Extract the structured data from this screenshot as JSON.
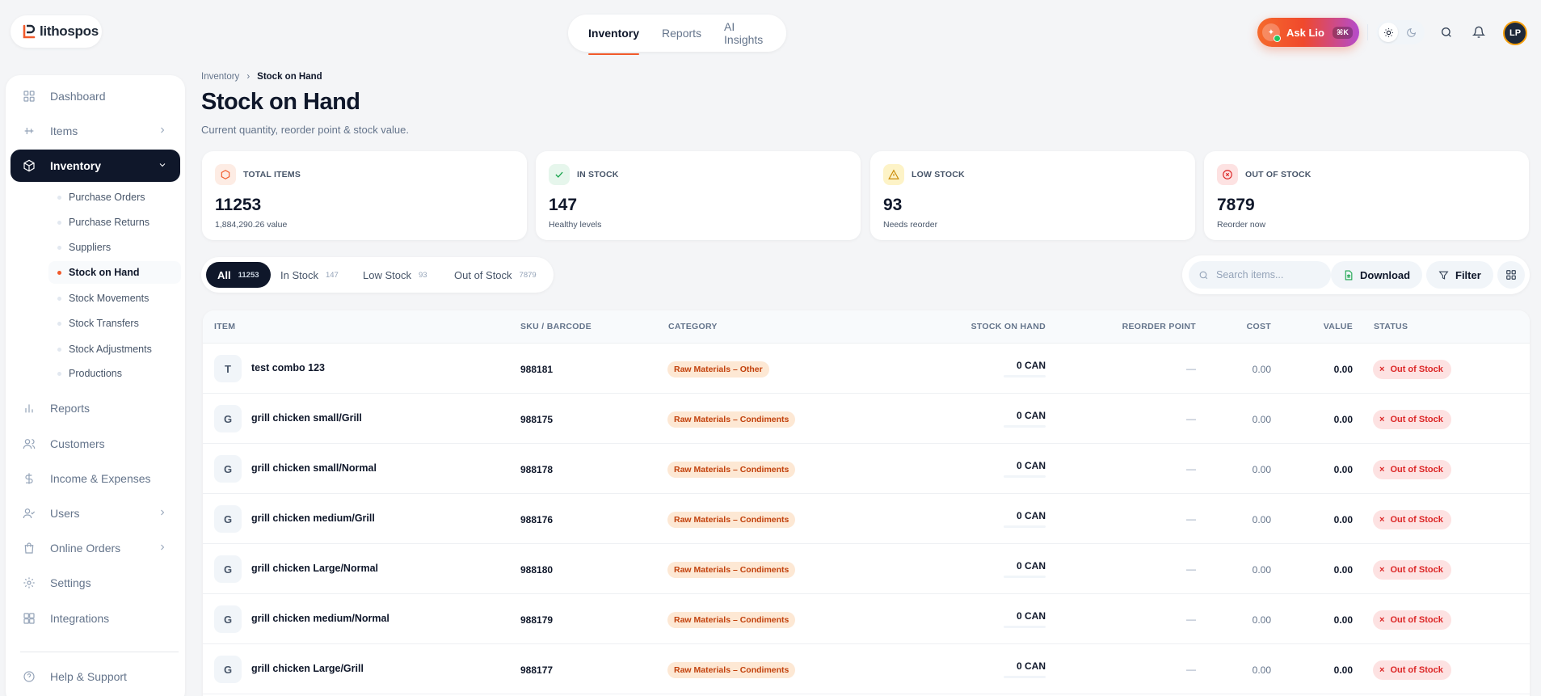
{
  "brand": {
    "name": "lithospos"
  },
  "topnav": [
    {
      "label": "Inventory",
      "active": true
    },
    {
      "label": "Reports",
      "active": false
    },
    {
      "label": "AI Insights",
      "active": false
    }
  ],
  "header": {
    "ask_label": "Ask Lio",
    "ask_shortcut": "⌘K",
    "avatar_initials": "LP"
  },
  "sidebar": {
    "items": [
      {
        "label": "Dashboard",
        "icon": "grid-icon"
      },
      {
        "label": "Items",
        "icon": "sliders-icon"
      },
      {
        "label": "Inventory",
        "icon": "box-icon"
      },
      {
        "label": "Reports",
        "icon": "bar-chart-icon"
      },
      {
        "label": "Customers",
        "icon": "users-icon"
      },
      {
        "label": "Income & Expenses",
        "icon": "dollar-icon"
      },
      {
        "label": "Users",
        "icon": "user-check-icon"
      },
      {
        "label": "Online Orders",
        "icon": "shopping-bag-icon"
      },
      {
        "label": "Settings",
        "icon": "gear-icon"
      },
      {
        "label": "Integrations",
        "icon": "apps-icon"
      },
      {
        "label": "Help & Support",
        "icon": "help-icon"
      }
    ],
    "subitems": [
      {
        "label": "Purchase Orders"
      },
      {
        "label": "Purchase Returns"
      },
      {
        "label": "Suppliers"
      },
      {
        "label": "Stock on Hand"
      },
      {
        "label": "Stock Movements"
      },
      {
        "label": "Stock Transfers"
      },
      {
        "label": "Stock Adjustments"
      },
      {
        "label": "Productions"
      }
    ]
  },
  "breadcrumb": {
    "parent": "Inventory",
    "separator": "›",
    "current": "Stock on Hand"
  },
  "page": {
    "title": "Stock on Hand",
    "subtitle": "Current quantity, reorder point & stock value."
  },
  "stats": [
    {
      "label": "TOTAL ITEMS",
      "value": "11253",
      "note": "1,884,290.26 value",
      "color": "#f15a2b",
      "bg": "#fdece4"
    },
    {
      "label": "IN STOCK",
      "value": "147",
      "note": "Healthy levels",
      "color": "#16a34a",
      "bg": "#e6f6ec"
    },
    {
      "label": "LOW STOCK",
      "value": "93",
      "note": "Needs reorder",
      "color": "#ca8a04",
      "bg": "#fdf3c7"
    },
    {
      "label": "OUT OF STOCK",
      "value": "7879",
      "note": "Reorder now",
      "color": "#dc2626",
      "bg": "#fde2e2"
    }
  ],
  "filters": [
    {
      "label": "All",
      "count": "11253",
      "active": true
    },
    {
      "label": "In Stock",
      "count": "147",
      "active": false
    },
    {
      "label": "Low Stock",
      "count": "93",
      "active": false
    },
    {
      "label": "Out of Stock",
      "count": "7879",
      "active": false
    }
  ],
  "toolbar": {
    "search_placeholder": "Search items...",
    "download_label": "Download",
    "filter_label": "Filter"
  },
  "table": {
    "columns": [
      "ITEM",
      "SKU / BARCODE",
      "CATEGORY",
      "STOCK ON HAND",
      "REORDER POINT",
      "COST",
      "VALUE",
      "STATUS"
    ],
    "rows": [
      {
        "initial": "T",
        "name": "test combo 123",
        "sku": "988181",
        "category": "Raw Materials – Other",
        "stock": "0 CAN",
        "reorder": "—",
        "cost": "0.00",
        "value": "0.00",
        "status": "Out of Stock"
      },
      {
        "initial": "G",
        "name": "grill chicken small/Grill",
        "sku": "988175",
        "category": "Raw Materials – Condiments",
        "stock": "0 CAN",
        "reorder": "—",
        "cost": "0.00",
        "value": "0.00",
        "status": "Out of Stock"
      },
      {
        "initial": "G",
        "name": "grill chicken small/Normal",
        "sku": "988178",
        "category": "Raw Materials – Condiments",
        "stock": "0 CAN",
        "reorder": "—",
        "cost": "0.00",
        "value": "0.00",
        "status": "Out of Stock"
      },
      {
        "initial": "G",
        "name": "grill chicken medium/Grill",
        "sku": "988176",
        "category": "Raw Materials – Condiments",
        "stock": "0 CAN",
        "reorder": "—",
        "cost": "0.00",
        "value": "0.00",
        "status": "Out of Stock"
      },
      {
        "initial": "G",
        "name": "grill chicken Large/Normal",
        "sku": "988180",
        "category": "Raw Materials – Condiments",
        "stock": "0 CAN",
        "reorder": "—",
        "cost": "0.00",
        "value": "0.00",
        "status": "Out of Stock"
      },
      {
        "initial": "G",
        "name": "grill chicken medium/Normal",
        "sku": "988179",
        "category": "Raw Materials – Condiments",
        "stock": "0 CAN",
        "reorder": "—",
        "cost": "0.00",
        "value": "0.00",
        "status": "Out of Stock"
      },
      {
        "initial": "G",
        "name": "grill chicken Large/Grill",
        "sku": "988177",
        "category": "Raw Materials – Condiments",
        "stock": "0 CAN",
        "reorder": "—",
        "cost": "0.00",
        "value": "0.00",
        "status": "Out of Stock"
      }
    ]
  },
  "colors": {
    "accent": "#f15a2b",
    "dark": "#0f172a",
    "danger": "#dc2626"
  }
}
